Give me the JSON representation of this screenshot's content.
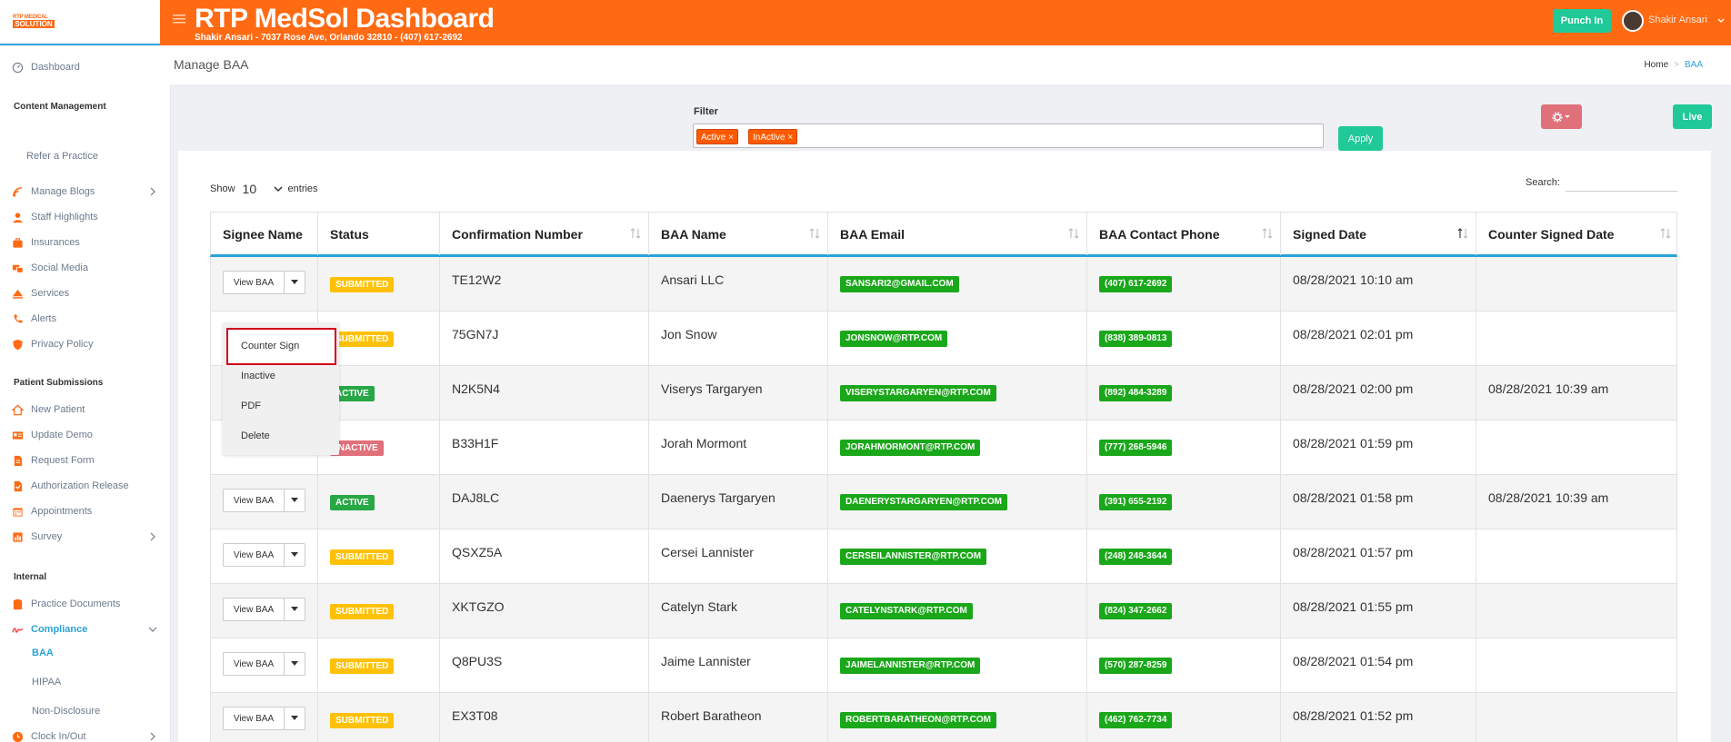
{
  "logo": {
    "line1": "RTP MEDICAL",
    "line2": "SOLUTION"
  },
  "header": {
    "title": "RTP MedSol Dashboard",
    "subtitle": "Shakir Ansari - 7037 Rose Ave, Orlando 32810 - (407) 617-2692",
    "punch_in": "Punch In",
    "user_name": "Shakir Ansari"
  },
  "sidebar": {
    "dashboard": "Dashboard",
    "content_management": "Content Management",
    "refer": "Refer a Practice",
    "content_items": [
      {
        "label": "Manage Blogs",
        "icon": "blog-icon",
        "has_arrow": true
      },
      {
        "label": "Staff Highlights",
        "icon": "user-icon",
        "has_arrow": false
      },
      {
        "label": "Insurances",
        "icon": "briefcase-icon",
        "has_arrow": false
      },
      {
        "label": "Social Media",
        "icon": "social-icon",
        "has_arrow": false
      },
      {
        "label": "Services",
        "icon": "services-icon",
        "has_arrow": false
      },
      {
        "label": "Alerts",
        "icon": "phone-icon",
        "has_arrow": false
      },
      {
        "label": "Privacy Policy",
        "icon": "shield-icon",
        "has_arrow": false
      }
    ],
    "patient_submissions": "Patient Submissions",
    "patient_items": [
      {
        "label": "New Patient",
        "icon": "home-icon",
        "has_arrow": false
      },
      {
        "label": "Update Demo",
        "icon": "id-card-icon",
        "has_arrow": false
      },
      {
        "label": "Request Form",
        "icon": "document-icon",
        "has_arrow": false
      },
      {
        "label": "Authorization Release",
        "icon": "check-doc-icon",
        "has_arrow": false
      },
      {
        "label": "Appointments",
        "icon": "calendar-icon",
        "has_arrow": false
      },
      {
        "label": "Survey",
        "icon": "chart-icon",
        "has_arrow": true
      }
    ],
    "internal": "Internal",
    "practice_documents": "Practice Documents",
    "compliance": "Compliance",
    "compliance_sub": [
      "BAA",
      "HIPAA",
      "Non-Disclosure"
    ],
    "clock": "Clock In/Out"
  },
  "page": {
    "title": "Manage BAA",
    "breadcrumb_home": "Home",
    "breadcrumb_current": "BAA"
  },
  "filter": {
    "label": "Filter",
    "tags": [
      "Active ×",
      "InActive ×"
    ],
    "apply": "Apply",
    "live": "Live"
  },
  "table_controls": {
    "show": "Show",
    "entries_value": "10",
    "entries": "entries",
    "search": "Search:"
  },
  "table": {
    "headers": [
      "Signee Name",
      "Status",
      "Confirmation Number",
      "BAA Name",
      "BAA Email",
      "BAA Contact Phone",
      "Signed Date",
      "Counter Signed Date"
    ],
    "view_label": "View BAA",
    "rows": [
      {
        "status": "SUBMITTED",
        "conf": "TE12W2",
        "name": "Ansari LLC",
        "email": "SANSARI2@GMAIL.COM",
        "phone": "(407) 617-2692",
        "signed": "08/28/2021 10:10 am",
        "counter": ""
      },
      {
        "status": "SUBMITTED",
        "conf": "75GN7J",
        "name": "Jon Snow",
        "email": "JONSNOW@RTP.COM",
        "phone": "(838) 389-0813",
        "signed": "08/28/2021 02:01 pm",
        "counter": ""
      },
      {
        "status": "ACTIVE",
        "conf": "N2K5N4",
        "name": "Viserys Targaryen",
        "email": "VISERYSTARGARYEN@RTP.COM",
        "phone": "(892) 484-3289",
        "signed": "08/28/2021 02:00 pm",
        "counter": "08/28/2021 10:39 am"
      },
      {
        "status": "INACTIVE",
        "conf": "B33H1F",
        "name": "Jorah Mormont",
        "email": "JORAHMORMONT@RTP.COM",
        "phone": "(777) 268-5946",
        "signed": "08/28/2021 01:59 pm",
        "counter": ""
      },
      {
        "status": "ACTIVE",
        "conf": "DAJ8LC",
        "name": "Daenerys Targaryen",
        "email": "DAENERYSTARGARYEN@RTP.COM",
        "phone": "(391) 655-2192",
        "signed": "08/28/2021 01:58 pm",
        "counter": "08/28/2021 10:39 am"
      },
      {
        "status": "SUBMITTED",
        "conf": "QSXZ5A",
        "name": "Cersei Lannister",
        "email": "CERSEILANNISTER@RTP.COM",
        "phone": "(248) 248-3644",
        "signed": "08/28/2021 01:57 pm",
        "counter": ""
      },
      {
        "status": "SUBMITTED",
        "conf": "XKTGZO",
        "name": "Catelyn Stark",
        "email": "CATELYNSTARK@RTP.COM",
        "phone": "(824) 347-2662",
        "signed": "08/28/2021 01:55 pm",
        "counter": ""
      },
      {
        "status": "SUBMITTED",
        "conf": "Q8PU3S",
        "name": "Jaime Lannister",
        "email": "JAIMELANNISTER@RTP.COM",
        "phone": "(570) 287-8259",
        "signed": "08/28/2021 01:54 pm",
        "counter": ""
      },
      {
        "status": "SUBMITTED",
        "conf": "EX3T08",
        "name": "Robert Baratheon",
        "email": "ROBERTBARATHEON@RTP.COM",
        "phone": "(462) 762-7734",
        "signed": "08/28/2021 01:52 pm",
        "counter": ""
      }
    ]
  },
  "dropdown": {
    "items": [
      "Counter Sign",
      "Inactive",
      "PDF",
      "Delete"
    ]
  },
  "colors": {
    "brand_orange": "#ff6a13",
    "teal": "#20c997",
    "accent_blue": "#2aa3d8",
    "submitted": "#ffc107",
    "active": "#28a745",
    "inactive": "#e0707a",
    "highlight_red": "#d0021b"
  }
}
